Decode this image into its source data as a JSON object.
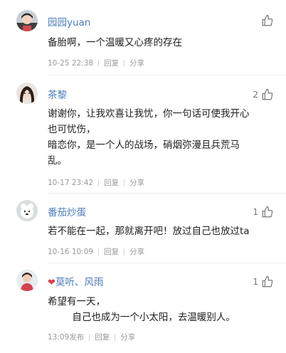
{
  "comments": [
    {
      "username": "园园yuan",
      "heart": "",
      "text": "备胎啊，一个温暖又心疼的存在",
      "time": "10-25 22:38",
      "reply_label": "回复",
      "share_label": "分享",
      "likes": ""
    },
    {
      "username": "茶黎",
      "heart": "",
      "text": "谢谢你，让我欢喜让我忧，你一句话可使我开心\n也可忧伤，\n暗恋你，是一个人的战场，硝烟弥漫且兵荒马\n乱。",
      "time": "10-17 23:42",
      "reply_label": "回复",
      "share_label": "分享",
      "likes": "2"
    },
    {
      "username": "番茄炒蛋",
      "heart": "",
      "text": "若不能在一起，那就离开吧！放过自己也放过ta",
      "time": "10-16 10:09",
      "reply_label": "回复",
      "share_label": "分享",
      "likes": "1"
    },
    {
      "username": "莫听、风雨",
      "heart": "❤",
      "text": "希望有一天，\n        自己也成为一个小太阳，去温暖别人。",
      "time": "13:09发布",
      "reply_label": "回复",
      "share_label": "分享",
      "likes": "1"
    }
  ],
  "icons": {
    "like": "thumbs-up-icon"
  },
  "colors": {
    "username": "#4a7cbc",
    "meta": "#9a9a9a",
    "heart": "#e0404a"
  }
}
